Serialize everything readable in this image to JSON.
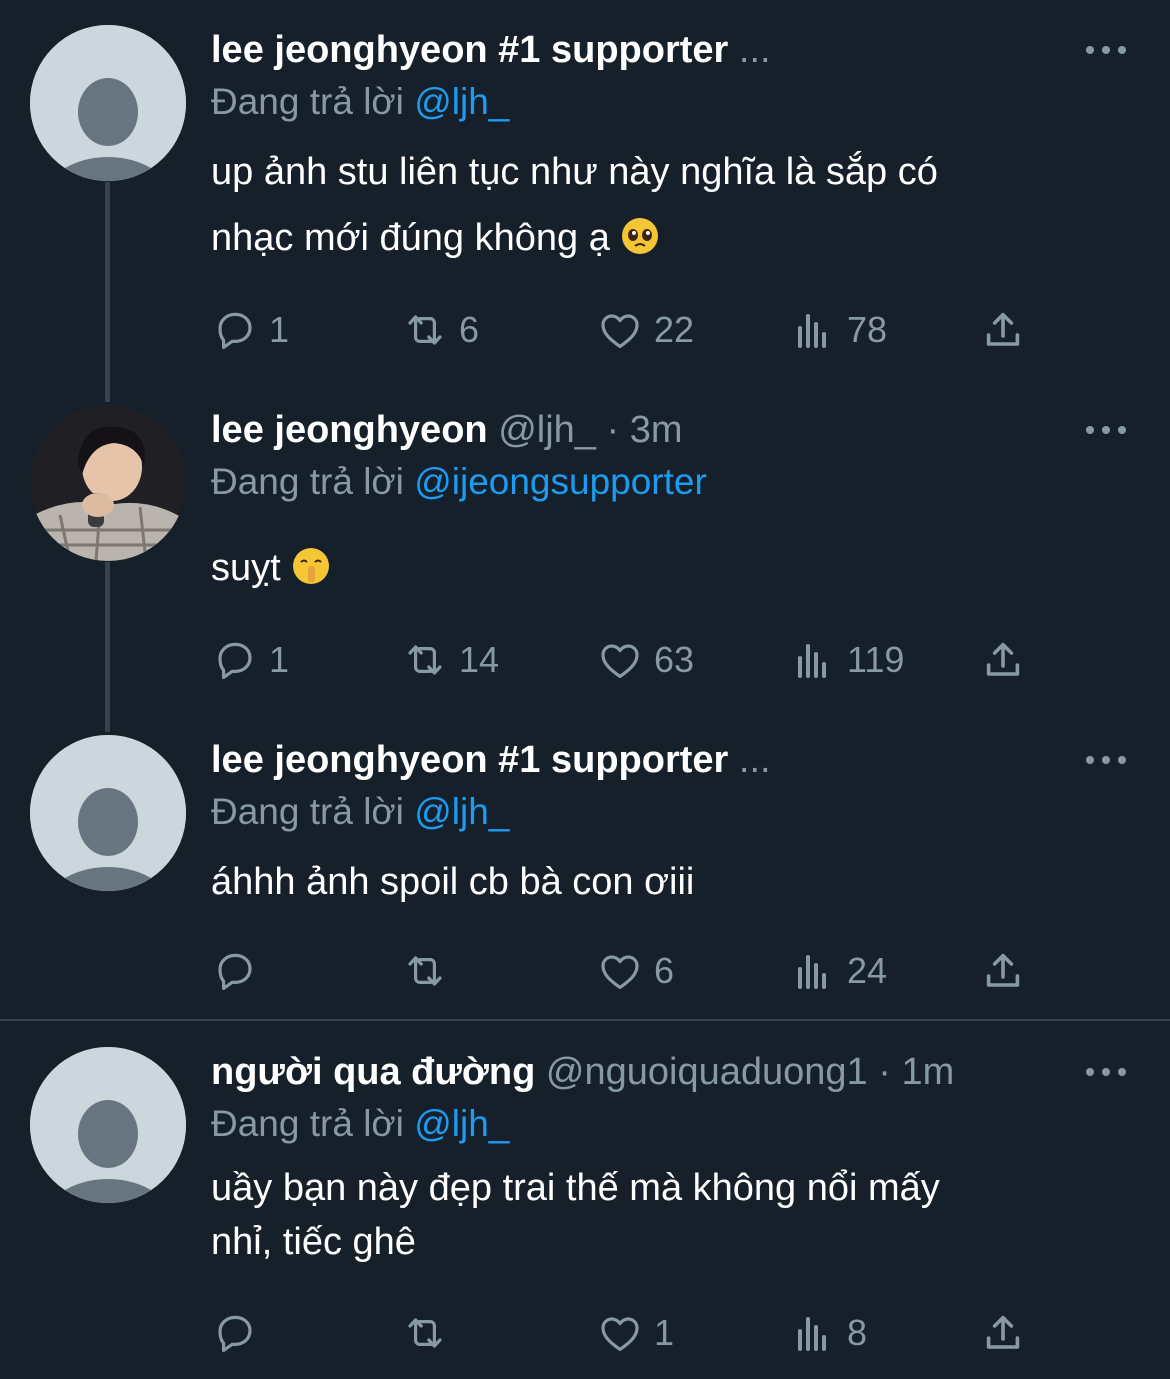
{
  "colors": {
    "background": "#15202b",
    "secondary_text": "#8899a6",
    "mention": "#1d9bf0",
    "divider": "#38444d"
  },
  "icons": [
    "reply-icon",
    "retweet-icon",
    "like-icon",
    "views-icon",
    "share-icon",
    "more-icon",
    "pleading-face-emoji",
    "shushing-face-emoji"
  ],
  "tweets": [
    {
      "name": "lee jeonghyeon #1 supporter",
      "ellipsis": "...",
      "replying_prefix": "Đang trả lời",
      "replying_to": "@ljh_",
      "text_line1": "up ảnh stu liên tục như này nghĩa là sắp có",
      "text_line2": "nhạc mới đúng không ạ",
      "reply_count": "1",
      "retweet_count": "6",
      "like_count": "22",
      "view_count": "78"
    },
    {
      "name": "lee jeonghyeon",
      "handle": "@ljh_",
      "separator": "·",
      "time": "3m",
      "replying_prefix": "Đang trả lời",
      "replying_to": "@ijeongsupporter",
      "text_line1": "suỵt",
      "reply_count": "1",
      "retweet_count": "14",
      "like_count": "63",
      "view_count": "119"
    },
    {
      "name": "lee jeonghyeon #1 supporter",
      "ellipsis": "...",
      "replying_prefix": "Đang trả lời",
      "replying_to": "@ljh_",
      "text_line1": "áhhh ảnh spoil cb bà con ơiii",
      "reply_count": "",
      "retweet_count": "",
      "like_count": "6",
      "view_count": "24"
    },
    {
      "name": "người qua đường",
      "handle": "@nguoiquaduong1",
      "separator": "·",
      "time": "1m",
      "replying_prefix": "Đang trả lời",
      "replying_to": "@ljh_",
      "text_line1": "uầy bạn này đẹp trai thế mà không nổi mấy",
      "text_line2": "nhỉ, tiếc ghê",
      "reply_count": "",
      "retweet_count": "",
      "like_count": "1",
      "view_count": "8"
    }
  ]
}
